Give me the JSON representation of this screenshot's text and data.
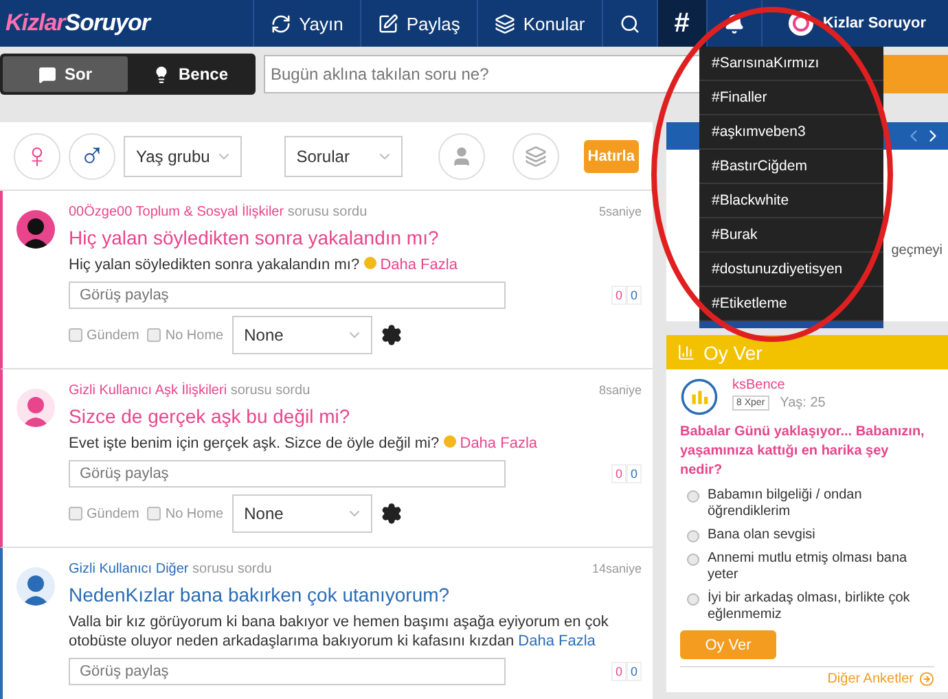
{
  "header": {
    "logo": [
      "Kizlar",
      "Soruyor"
    ],
    "nav": [
      {
        "kind": "refresh",
        "label": "Yayın",
        "selected": false
      },
      {
        "kind": "edit",
        "label": "Paylaş",
        "selected": false
      },
      {
        "kind": "books",
        "label": "Konular",
        "selected": false
      },
      {
        "kind": "search",
        "selected": false
      },
      {
        "kind": "hash",
        "glyph": "#",
        "selected": true
      },
      {
        "kind": "bell",
        "selected": false
      },
      {
        "kind": "profile",
        "label": "Kizlar Soruyor",
        "selected": false
      }
    ]
  },
  "askbar": {
    "modes": [
      {
        "kind": "chat",
        "label": "Sor",
        "selected": true
      },
      {
        "kind": "bulb",
        "label": "Bence",
        "selected": false
      }
    ],
    "search": {
      "placeholder": "Bugün aklına takılan soru ne?"
    }
  },
  "filters": {
    "genders": [
      {
        "kind": "female",
        "glyph": "♀"
      },
      {
        "kind": "male",
        "glyph": "♂"
      }
    ],
    "age": "Yaş grubu",
    "type": "Sorular",
    "remind": "Hatırla"
  },
  "posts": [
    {
      "kind": "female",
      "user": "00Özge00",
      "category": "Toplum & Sosyal İlişkiler",
      "action": "sorusu sordu",
      "time": "5saniye",
      "title": "Hiç yalan söyledikten sonra yakalandın mı?",
      "body": "Hiç yalan söyledikten sonra yakalandın mı?",
      "emoji": true,
      "more": "Daha Fazla",
      "placeholder": "Görüş paylaş",
      "counts": [
        "0",
        "0"
      ],
      "checks": [
        {
          "label": "Gündem",
          "checked": false
        },
        {
          "label": "No Home",
          "checked": false
        }
      ],
      "select": "None",
      "anonymous": false
    },
    {
      "kind": "female",
      "user": "Gizli Kullanıcı",
      "category": "Aşk İlişkileri",
      "action": "sorusu sordu",
      "time": "8saniye",
      "title": "Sizce de gerçek aşk bu değil mi?",
      "body": "Evet işte benim için gerçek aşk. Sizce de öyle değil mi?",
      "emoji": true,
      "more": "Daha Fazla",
      "placeholder": "Görüş paylaş",
      "counts": [
        "0",
        "0"
      ],
      "checks": [
        {
          "label": "Gündem",
          "checked": false
        },
        {
          "label": "No Home",
          "checked": false
        }
      ],
      "select": "None",
      "anonymous": true
    },
    {
      "kind": "male",
      "user": "Gizli Kullanıcı",
      "category": "Diğer",
      "action": "sorusu sordu",
      "time": "14saniye",
      "title": "NedenKızlar bana bakırken çok utanıyorum?",
      "body": "Valla bir kız görüyorum ki bana bakıyor ve hemen başımı aşağa eyiyorum en çok otobüste oluyor neden arkadaşlarıma bakıyorum ki kafasını kızdan",
      "emoji": false,
      "more": "Daha Fazla",
      "placeholder": "Görüş paylaş",
      "counts": [
        "0",
        "0"
      ],
      "anonymous": true
    }
  ],
  "news": {
    "fragment": "geçmeyi"
  },
  "hashtags": [
    {
      "label": "#SarısınaKırmızı"
    },
    {
      "label": "#Finaller"
    },
    {
      "label": "#aşkımveben3"
    },
    {
      "label": "#BastırCiğdem"
    },
    {
      "label": "#Blackwhite"
    },
    {
      "label": "#Burak"
    },
    {
      "label": "#dostunuzdiyetisyen"
    },
    {
      "label": "#Etiketleme"
    }
  ],
  "poll": {
    "title": "Oy Ver",
    "user": "ksBence",
    "level_badge": "8",
    "rank": "Xper",
    "age": "Yaş: 25",
    "question": "Babalar Günü yaklaşıyor... Babanızın, yaşamınıza kattığı en harika şey nedir?",
    "options": [
      {
        "label": "Babamın bilgeliği / ondan öğrendiklerim",
        "selected": false
      },
      {
        "label": "Bana olan sevgisi",
        "selected": false
      },
      {
        "label": "Annemi mutlu etmiş olması bana yeter",
        "selected": false
      },
      {
        "label": "İyi bir arkadaş olması, birlikte çok eğlenmemiz",
        "selected": false
      }
    ],
    "button": "Oy Ver",
    "more": "Diğer Anketler"
  }
}
